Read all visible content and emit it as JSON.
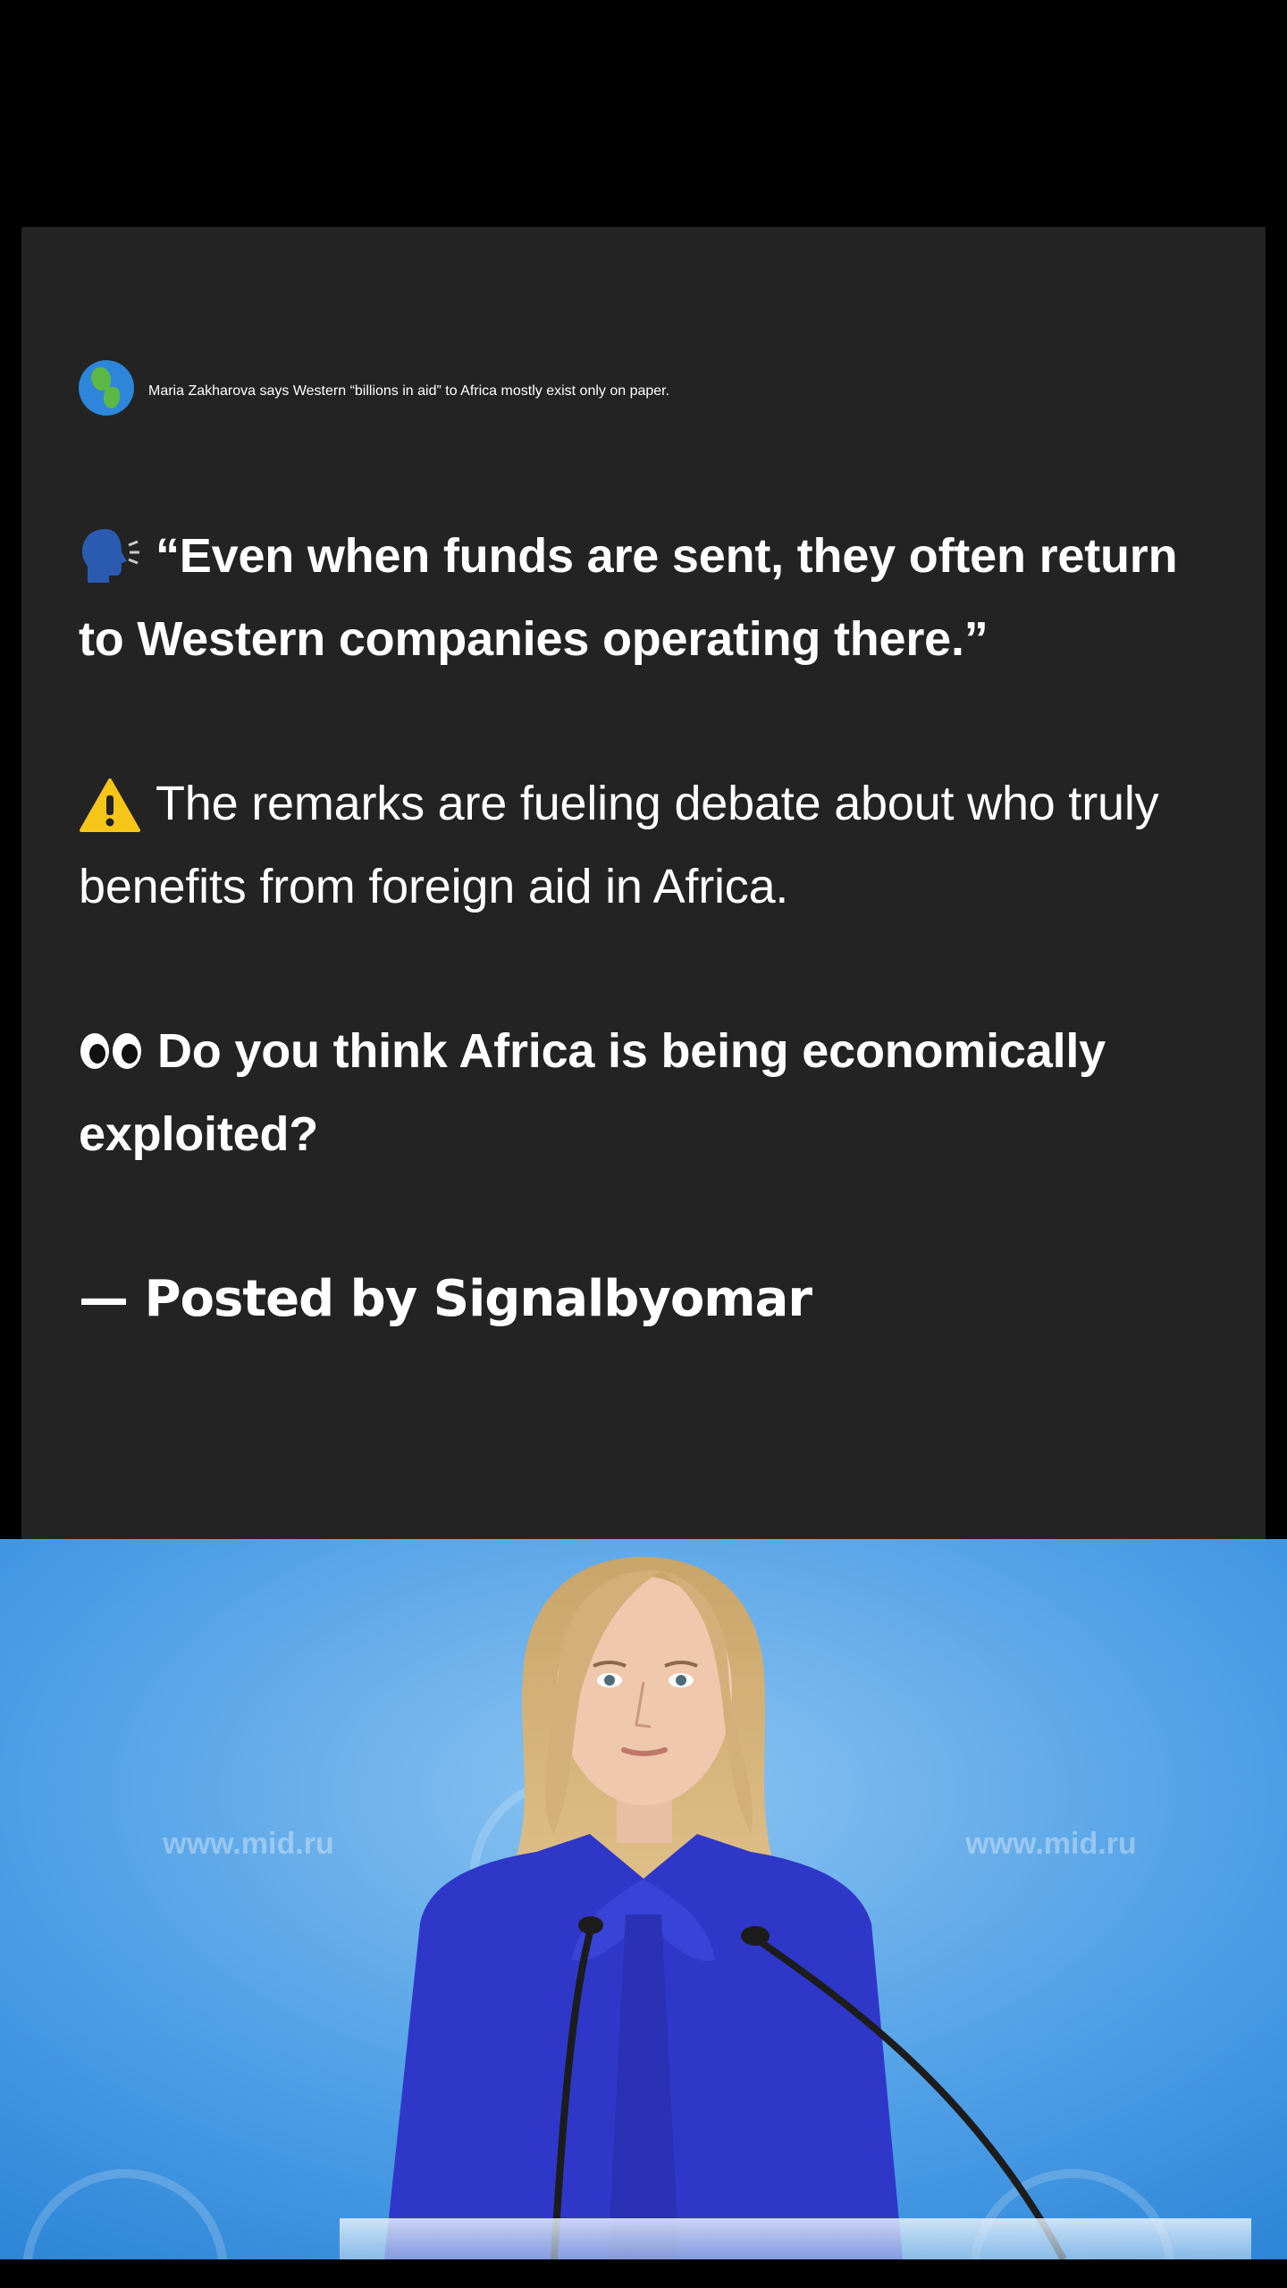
{
  "post": {
    "paragraph1": "Maria Zakharova says Western “billions in aid” to Africa mostly exist only on paper.",
    "paragraph2": "“Even when funds are sent, they often return to Western companies operating there.”",
    "paragraph3": "The remarks are fueling debate about who truly benefits from foreign aid in Africa.",
    "paragraph4": "Do you think Africa is being economically exploited?",
    "signature": "— Posted by Signalbyomar"
  },
  "icons": [
    "russia-flag-icon",
    "globe-icon",
    "speaking-head-icon",
    "warning-icon",
    "eyes-icon"
  ],
  "photo": {
    "watermark_left": "www.mid.ru",
    "watermark_right": "www.mid.ru"
  },
  "colors": {
    "page_background": "#000000",
    "card_background": "#232323",
    "text": "#ffffff",
    "photo_background": "#4a9be4",
    "jacket": "#2f37c9"
  }
}
